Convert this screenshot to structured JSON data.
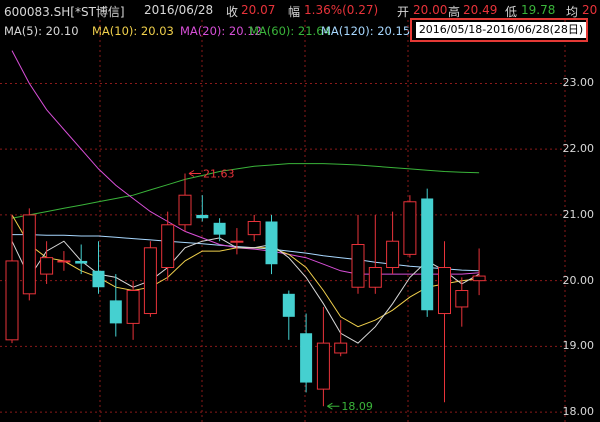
{
  "header": {
    "code": "600083.SH[*ST博信]",
    "date": "2016/06/28",
    "close_label": "收",
    "close_value": "20.07",
    "change_label": "幅",
    "change_value": "1.36%(0.27)",
    "open_label": "开",
    "open_value": "20.00",
    "high_label": "高",
    "high_value": "20.49",
    "low_label": "低",
    "low_value": "19.78",
    "avg_label": "均",
    "avg_value": "20"
  },
  "ma_bar": {
    "ma5": "MA(5): 20.10",
    "ma10": "MA(10): 20.03",
    "ma20": "MA(20): 20.12",
    "ma60": "MA(60): 21.64",
    "ma120": "MA(120): 20.15"
  },
  "range_label": "2016/05/18-2016/06/28(28日)",
  "colors": {
    "up": "#e8333a",
    "down": "#45d0d0",
    "ma5": "#d8d8d8",
    "ma10": "#f0d04c",
    "ma20": "#d84fd8",
    "ma60": "#3ab43a",
    "ma120": "#a8d8ff",
    "grid": "#8a1a1a",
    "highlight": "#e53935"
  },
  "chart_data": {
    "type": "candlestick",
    "y_ticks": [
      "23.00",
      "22.00",
      "21.00",
      "20.00",
      "19.00",
      "18.00"
    ],
    "ylim": [
      17.85,
      23.6
    ],
    "candles": [
      {
        "o": 19.1,
        "c": 20.3,
        "h": 21.0,
        "l": 19.05
      },
      {
        "o": 19.8,
        "c": 21.0,
        "h": 21.1,
        "l": 19.7
      },
      {
        "o": 20.1,
        "c": 20.35,
        "h": 20.6,
        "l": 19.95
      },
      {
        "o": 20.3,
        "c": 20.3,
        "h": 20.45,
        "l": 20.15
      },
      {
        "o": 20.3,
        "c": 20.26,
        "h": 20.55,
        "l": 20.1
      },
      {
        "o": 20.15,
        "c": 19.9,
        "h": 20.6,
        "l": 19.8
      },
      {
        "o": 19.7,
        "c": 19.35,
        "h": 20.1,
        "l": 19.15
      },
      {
        "o": 19.35,
        "c": 19.85,
        "h": 20.0,
        "l": 19.1
      },
      {
        "o": 19.5,
        "c": 20.5,
        "h": 20.6,
        "l": 19.45
      },
      {
        "o": 20.2,
        "c": 20.85,
        "h": 21.05,
        "l": 20.0
      },
      {
        "o": 20.85,
        "c": 21.3,
        "h": 21.63,
        "l": 20.75
      },
      {
        "o": 21.0,
        "c": 20.95,
        "h": 21.3,
        "l": 20.9
      },
      {
        "o": 20.88,
        "c": 20.7,
        "h": 20.95,
        "l": 20.6
      },
      {
        "o": 20.6,
        "c": 20.6,
        "h": 20.8,
        "l": 20.4
      },
      {
        "o": 20.7,
        "c": 20.9,
        "h": 21.0,
        "l": 20.6
      },
      {
        "o": 20.9,
        "c": 20.25,
        "h": 21.0,
        "l": 20.1
      },
      {
        "o": 19.8,
        "c": 19.45,
        "h": 19.85,
        "l": 19.1
      },
      {
        "o": 19.2,
        "c": 18.45,
        "h": 19.5,
        "l": 18.3
      },
      {
        "o": 18.35,
        "c": 19.05,
        "h": 19.6,
        "l": 18.09
      },
      {
        "o": 18.9,
        "c": 19.05,
        "h": 19.4,
        "l": 18.85
      },
      {
        "o": 19.9,
        "c": 20.55,
        "h": 21.0,
        "l": 19.8
      },
      {
        "o": 19.9,
        "c": 20.2,
        "h": 21.0,
        "l": 19.8
      },
      {
        "o": 20.2,
        "c": 20.6,
        "h": 21.05,
        "l": 20.1
      },
      {
        "o": 20.4,
        "c": 21.2,
        "h": 21.3,
        "l": 20.35
      },
      {
        "o": 21.25,
        "c": 19.55,
        "h": 21.4,
        "l": 19.45
      },
      {
        "o": 19.5,
        "c": 20.2,
        "h": 20.6,
        "l": 18.15
      },
      {
        "o": 19.6,
        "c": 19.85,
        "h": 20.05,
        "l": 19.3
      },
      {
        "o": 20.0,
        "c": 20.07,
        "h": 20.49,
        "l": 19.78
      }
    ],
    "ma5": [
      20.6,
      20.05,
      20.45,
      20.6,
      20.3,
      20.1,
      20.05,
      19.9,
      20.0,
      20.2,
      20.5,
      20.6,
      20.65,
      20.5,
      20.5,
      20.55,
      20.35,
      20.05,
      19.65,
      19.2,
      19.05,
      19.3,
      19.65,
      20.05,
      20.3,
      20.15,
      19.95,
      20.1
    ],
    "ma10": [
      21.0,
      20.55,
      20.35,
      20.3,
      20.15,
      20.05,
      19.9,
      19.85,
      19.9,
      20.05,
      20.3,
      20.45,
      20.45,
      20.5,
      20.5,
      20.5,
      20.4,
      20.2,
      19.85,
      19.45,
      19.3,
      19.4,
      19.55,
      19.75,
      19.9,
      19.95,
      20.0,
      20.03
    ],
    "ma20": [
      23.5,
      23.0,
      22.6,
      22.3,
      22.0,
      21.7,
      21.45,
      21.25,
      21.05,
      20.9,
      20.75,
      20.65,
      20.55,
      20.5,
      20.48,
      20.45,
      20.4,
      20.35,
      20.25,
      20.15,
      20.1,
      20.1,
      20.1,
      20.1,
      20.1,
      20.1,
      20.1,
      20.12
    ],
    "ma60": [
      20.95,
      21.0,
      21.05,
      21.1,
      21.15,
      21.2,
      21.25,
      21.3,
      21.38,
      21.46,
      21.54,
      21.6,
      21.66,
      21.7,
      21.74,
      21.76,
      21.78,
      21.78,
      21.78,
      21.77,
      21.76,
      21.74,
      21.72,
      21.7,
      21.68,
      21.66,
      21.65,
      21.64
    ],
    "ma120": [
      20.7,
      20.7,
      20.69,
      20.69,
      20.68,
      20.68,
      20.66,
      20.64,
      20.62,
      20.6,
      20.58,
      20.56,
      20.54,
      20.52,
      20.5,
      20.48,
      20.45,
      20.42,
      20.38,
      20.35,
      20.32,
      20.28,
      20.25,
      20.22,
      20.2,
      20.18,
      20.16,
      20.15
    ],
    "annotations": [
      {
        "label": "21.63",
        "index": 10,
        "value": 21.63
      },
      {
        "label": "18.09",
        "index": 18,
        "value": 18.09
      }
    ]
  }
}
